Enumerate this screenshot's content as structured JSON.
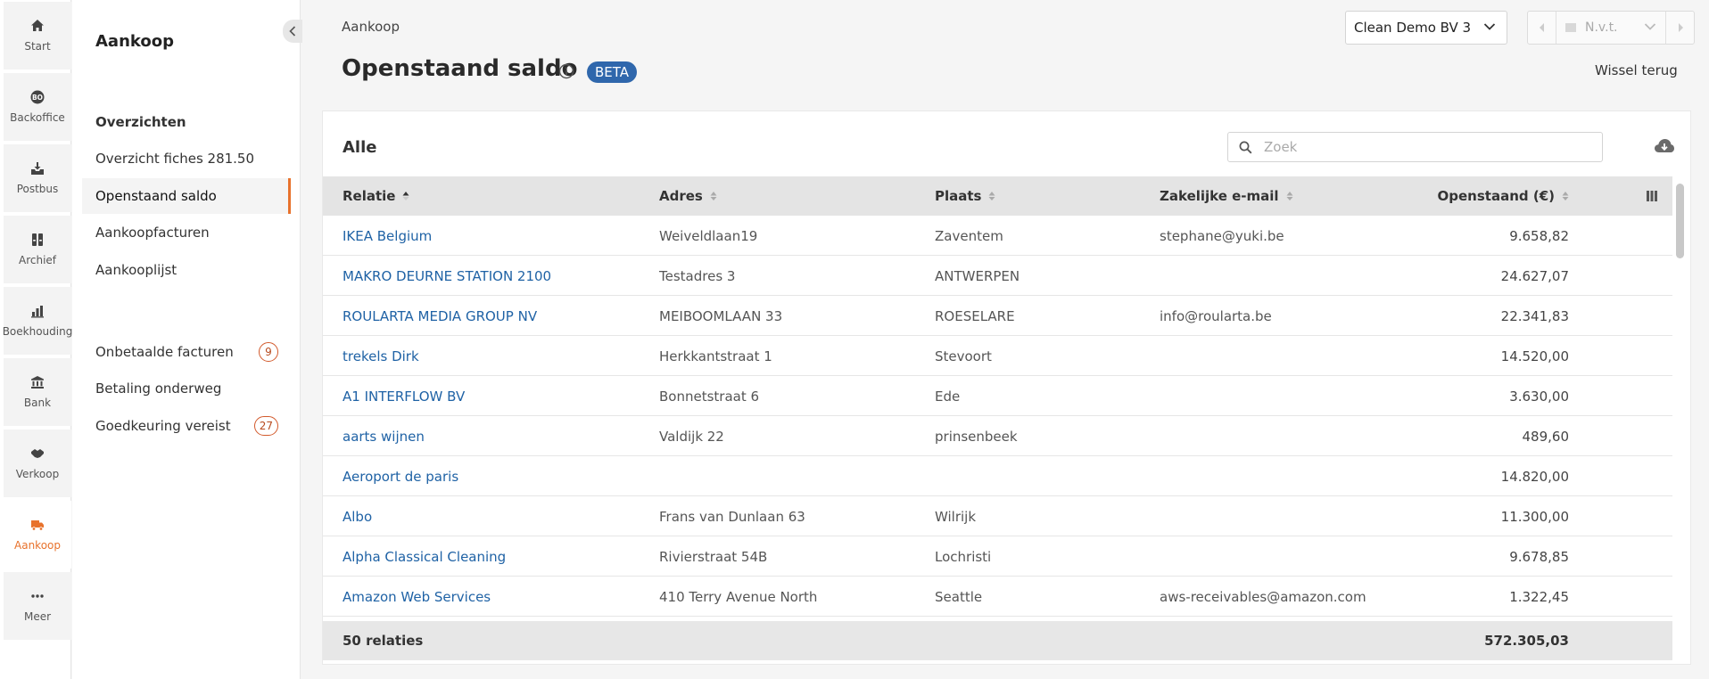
{
  "rail": [
    {
      "key": "start",
      "label": "Start",
      "icon": "home-icon"
    },
    {
      "key": "backoffice",
      "label": "Backoffice",
      "icon": "bo-icon"
    },
    {
      "key": "postbus",
      "label": "Postbus",
      "icon": "inbox-icon"
    },
    {
      "key": "archief",
      "label": "Archief",
      "icon": "archive-icon"
    },
    {
      "key": "boekhouding",
      "label": "Boekhouding",
      "icon": "bar-chart-icon"
    },
    {
      "key": "bank",
      "label": "Bank",
      "icon": "bank-icon"
    },
    {
      "key": "verkoop",
      "label": "Verkoop",
      "icon": "handshake-icon"
    },
    {
      "key": "aankoop",
      "label": "Aankoop",
      "icon": "truck-icon",
      "active": true
    },
    {
      "key": "meer",
      "label": "Meer",
      "icon": "more-icon"
    }
  ],
  "rail_icon_labels": {
    "backoffice": "BO"
  },
  "sidebar": {
    "title": "Aankoop",
    "section": "Overzichten",
    "items": [
      {
        "label": "Overzicht fiches 281.50"
      },
      {
        "label": "Openstaand saldo",
        "active": true
      },
      {
        "label": "Aankoopfacturen"
      },
      {
        "label": "Aankooplijst"
      }
    ],
    "items2": [
      {
        "label": "Onbetaalde facturen",
        "badge": "9"
      },
      {
        "label": "Betaling onderweg"
      },
      {
        "label": "Goedkeuring vereist",
        "badge": "27"
      }
    ]
  },
  "header": {
    "breadcrumb": "Aankoop",
    "title": "Openstaand saldo",
    "beta": "BETA",
    "company": "Clean Demo BV 3",
    "period": "N.v.t.",
    "switch_back": "Wissel terug"
  },
  "card": {
    "title": "Alle",
    "search_placeholder": "Zoek"
  },
  "table": {
    "columns": [
      "Relatie",
      "Adres",
      "Plaats",
      "Zakelijke e-mail",
      "Openstaand (€)"
    ],
    "rows": [
      {
        "relatie": "IKEA Belgium",
        "adres": "Weiveldlaan19",
        "plaats": "Zaventem",
        "email": "stephane@yuki.be",
        "openstaand": "9.658,82"
      },
      {
        "relatie": "MAKRO DEURNE STATION 2100",
        "adres": "Testadres 3",
        "plaats": "ANTWERPEN",
        "email": "",
        "openstaand": "24.627,07"
      },
      {
        "relatie": "ROULARTA MEDIA GROUP NV",
        "adres": "MEIBOOMLAAN 33",
        "plaats": "ROESELARE",
        "email": "info@roularta.be",
        "openstaand": "22.341,83"
      },
      {
        "relatie": "trekels Dirk",
        "adres": "Herkkantstraat 1",
        "plaats": "Stevoort",
        "email": "",
        "openstaand": "14.520,00"
      },
      {
        "relatie": "A1 INTERFLOW BV",
        "adres": "Bonnetstraat 6",
        "plaats": "Ede",
        "email": "",
        "openstaand": "3.630,00"
      },
      {
        "relatie": "aarts wijnen",
        "adres": "Valdijk 22",
        "plaats": "prinsenbeek",
        "email": "",
        "openstaand": "489,60"
      },
      {
        "relatie": "Aeroport de paris",
        "adres": "",
        "plaats": "",
        "email": "",
        "openstaand": "14.820,00"
      },
      {
        "relatie": "Albo",
        "adres": "Frans van Dunlaan 63",
        "plaats": "Wilrijk",
        "email": "",
        "openstaand": "11.300,00"
      },
      {
        "relatie": "Alpha Classical Cleaning",
        "adres": "Rivierstraat 54B",
        "plaats": "Lochristi",
        "email": "",
        "openstaand": "9.678,85"
      },
      {
        "relatie": "Amazon Web Services",
        "adres": "410 Terry Avenue North",
        "plaats": "Seattle",
        "email": "aws-receivables@amazon.com",
        "openstaand": "1.322,45"
      }
    ],
    "footer": {
      "count": "50 relaties",
      "total": "572.305,03"
    }
  },
  "colors": {
    "accent": "#e8722c",
    "link": "#1f62a5",
    "beta": "#2f67ac",
    "badge": "#d2592b"
  }
}
